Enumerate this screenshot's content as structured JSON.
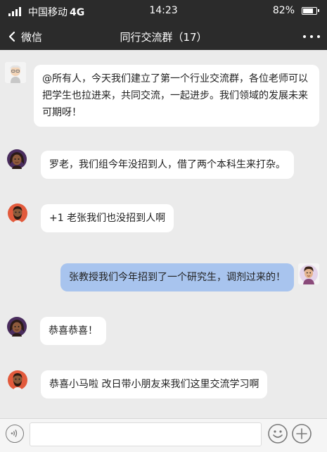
{
  "status_bar": {
    "carrier": "中国移动",
    "network": "4G",
    "time": "14:23",
    "battery": "82%"
  },
  "nav": {
    "back_label": "微信",
    "title": "同行交流群（17）"
  },
  "messages": [
    {
      "sender_icon": "elderly-man-avatar-icon",
      "outgoing": false,
      "text": "@所有人，今天我们建立了第一个行业交流群，各位老师可以把学生也拉进来，共同交流，一起进步。我们领域的发展未来可期呀！"
    },
    {
      "sender_icon": "woman-avatar-icon",
      "outgoing": false,
      "text": "罗老，我们组今年没招到人，借了两个本科生来打杂。"
    },
    {
      "sender_icon": "bearded-man-avatar-icon",
      "outgoing": false,
      "text": "+1 老张我们也没招到人啊"
    },
    {
      "sender_icon": "man-avatar-icon",
      "outgoing": true,
      "text": "张教授我们今年招到了一个研究生，调剂过来的！"
    },
    {
      "sender_icon": "woman-avatar-icon",
      "outgoing": false,
      "text": "恭喜恭喜！"
    },
    {
      "sender_icon": "bearded-man-avatar-icon",
      "outgoing": false,
      "text": "恭喜小马啦 改日带小朋友来我们这里交流学习啊"
    }
  ],
  "colors": {
    "header": "#2b2b2b",
    "chat_background": "#ebebeb",
    "incoming_bubble": "#ffffff",
    "outgoing_bubble": "#a8c4ee"
  }
}
